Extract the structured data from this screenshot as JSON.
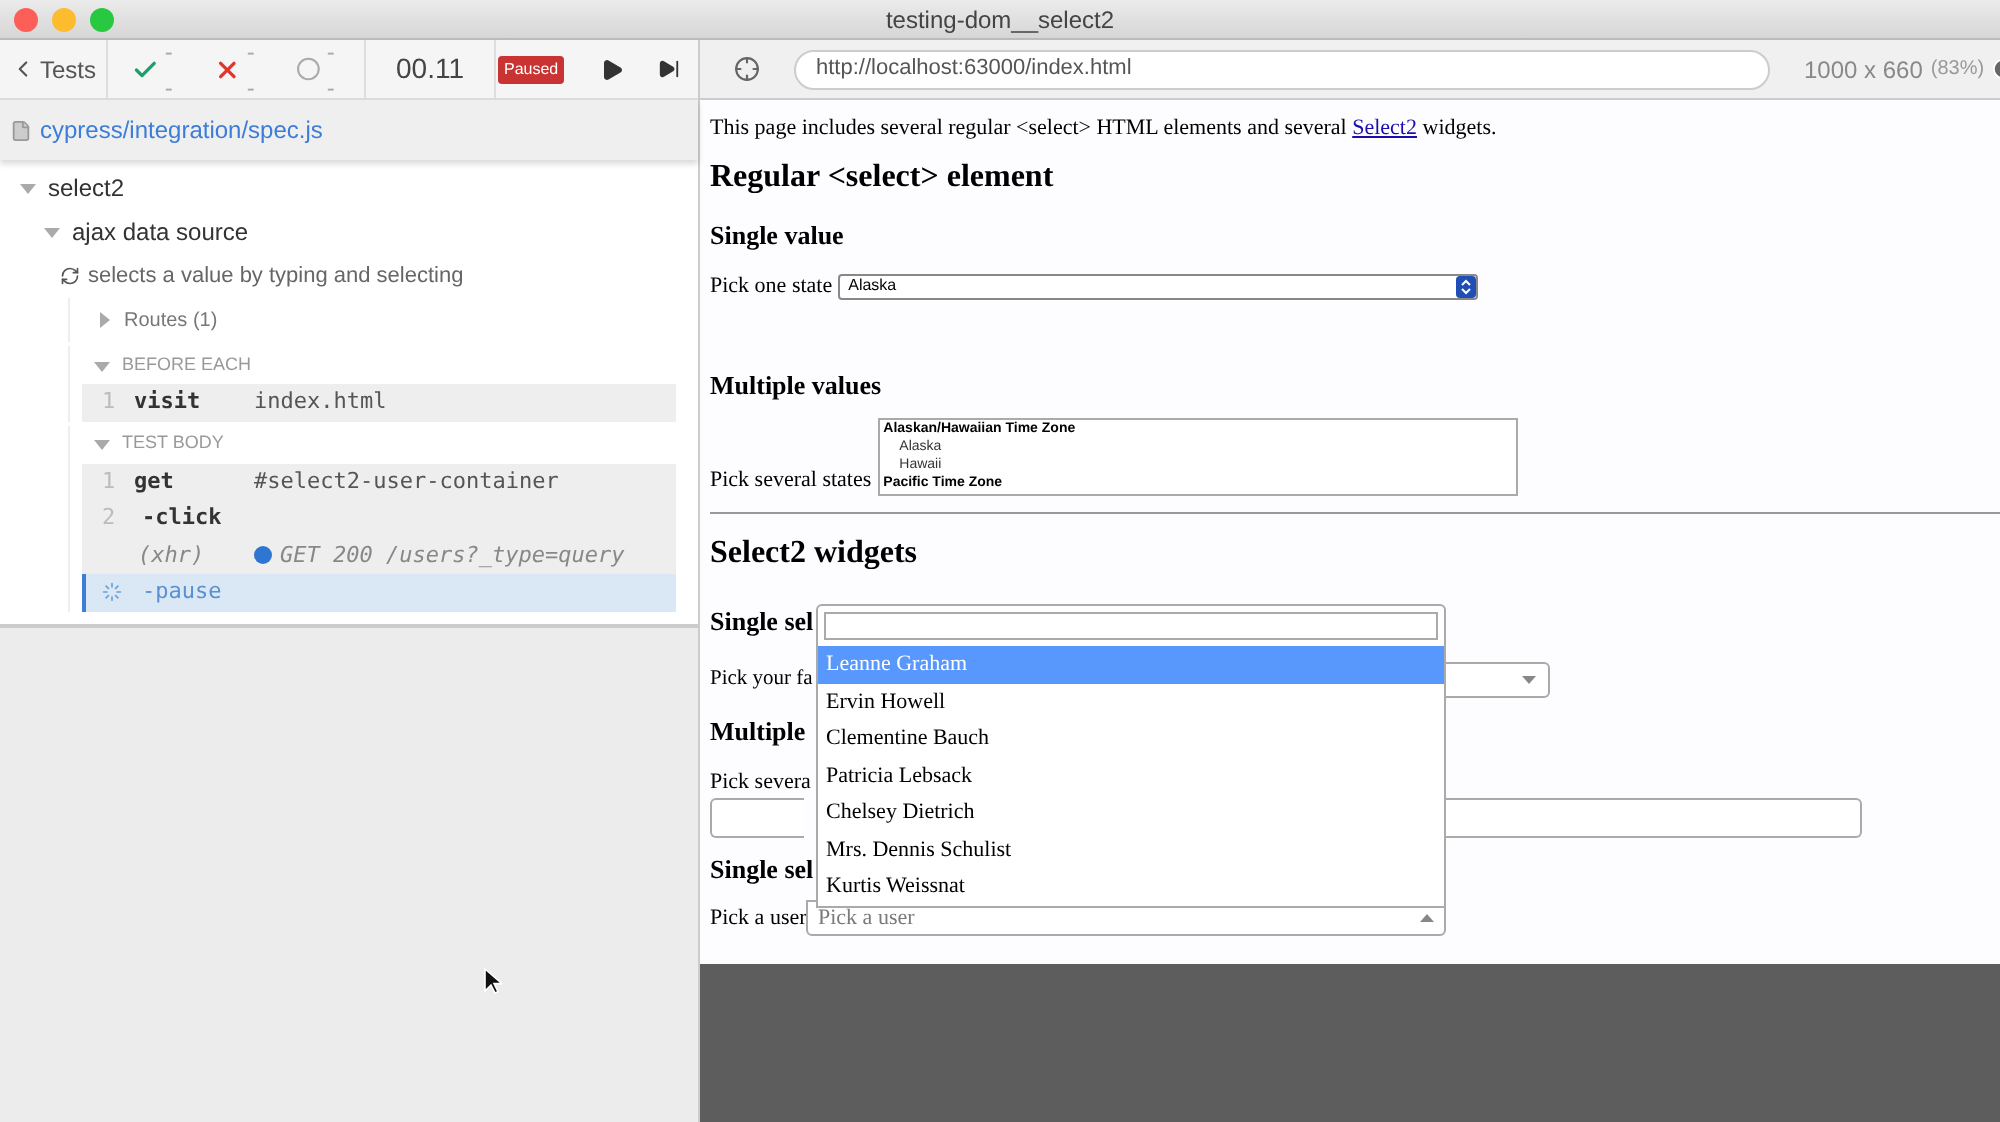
{
  "window": {
    "title": "testing-dom__select2"
  },
  "reporter": {
    "back": "Tests",
    "stats": [
      {
        "kind": "passed",
        "value": "--"
      },
      {
        "kind": "failed",
        "value": "--"
      },
      {
        "kind": "pending",
        "value": "--"
      }
    ],
    "duration": "00.11",
    "status": "Paused",
    "spec": "cypress/integration/spec.js",
    "suites": [
      {
        "title": "select2",
        "expanded": true,
        "children": [
          {
            "title": "ajax data source",
            "expanded": true,
            "tests": [
              {
                "title": "selects a value by typing and selecting",
                "routes": {
                  "label": "Routes (1)",
                  "expanded": false
                },
                "hooks": [
                  {
                    "title": "BEFORE EACH",
                    "expanded": true,
                    "commands": [
                      {
                        "kind": "command",
                        "number": "1",
                        "name": "visit",
                        "message": "index.html",
                        "selected": false
                      }
                    ]
                  },
                  {
                    "title": "TEST BODY",
                    "expanded": true,
                    "commands": [
                      {
                        "kind": "command",
                        "number": "1",
                        "name": "get",
                        "message": "#select2-user-container",
                        "selected": false
                      },
                      {
                        "kind": "child",
                        "number": "2",
                        "name": "-click",
                        "selected": false
                      },
                      {
                        "kind": "xhr",
                        "name": "(xhr)",
                        "message": "GET 200 /users?_type=query",
                        "selected": false
                      },
                      {
                        "kind": "pending",
                        "name": "-pause",
                        "selected": true
                      }
                    ]
                  }
                ]
              }
            ]
          }
        ]
      }
    ]
  },
  "browser": {
    "url": "http://localhost:63000/index.html",
    "viewport": "1000 x 660",
    "scale": "(83%)"
  },
  "page": {
    "intro": "This page includes several regular <select> HTML elements and several ",
    "intro_link": "Select2",
    "intro_end": " widgets.",
    "heading_1": "Regular <select> element",
    "single_heading": "Single value",
    "single_label": "Pick one state",
    "single_value": "Alaska",
    "multiple_heading": "Multiple values",
    "multiple_label": "Pick several states",
    "multiple_options": [
      {
        "kind": "group",
        "label": "Alaskan/Hawaiian Time Zone"
      },
      {
        "kind": "option",
        "label": "Alaska"
      },
      {
        "kind": "option",
        "label": "Hawaii"
      },
      {
        "kind": "group",
        "label": "Pacific Time Zone"
      }
    ],
    "heading_2": "Select2 widgets",
    "s2_single_heading": "Single sel",
    "s2_single_label": "Pick your fa",
    "s2_multiple_heading": "Multiple",
    "s2_multiple_label": "Pick severa",
    "s2_user_heading": "Single sel",
    "s2_user_label": "Pick a user",
    "s2_user_placeholder": "Pick a user",
    "dropdown": {
      "options": [
        {
          "label": "Leanne Graham",
          "selected": true
        },
        {
          "label": "Ervin Howell",
          "selected": false
        },
        {
          "label": "Clementine Bauch",
          "selected": false
        },
        {
          "label": "Patricia Lebsack",
          "selected": false
        },
        {
          "label": "Chelsey Dietrich",
          "selected": false
        },
        {
          "label": "Mrs. Dennis Schulist",
          "selected": false
        },
        {
          "label": "Kurtis Weissnat",
          "selected": false
        }
      ]
    }
  }
}
